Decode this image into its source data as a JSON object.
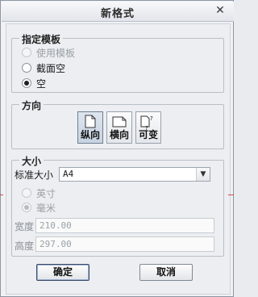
{
  "window": {
    "title": "新格式"
  },
  "template_group": {
    "label": "指定模板",
    "options": [
      {
        "label": "使用模板",
        "checked": false,
        "enabled": false
      },
      {
        "label": "截面空",
        "checked": false,
        "enabled": true
      },
      {
        "label": "空",
        "checked": true,
        "enabled": true
      }
    ]
  },
  "orientation_group": {
    "label": "方向",
    "buttons": [
      {
        "label": "纵向",
        "icon": "portrait-page-icon",
        "active": true
      },
      {
        "label": "横向",
        "icon": "landscape-page-icon",
        "active": false
      },
      {
        "label": "可变",
        "icon": "variable-page-icon",
        "active": false
      }
    ]
  },
  "size_group": {
    "label": "大小",
    "standard_size_label": "标准大小",
    "standard_size_value": "A4",
    "units": [
      {
        "label": "英寸",
        "checked": false,
        "enabled": false
      },
      {
        "label": "毫米",
        "checked": true,
        "enabled": false
      }
    ],
    "width_label": "宽度",
    "width_value": "210.00",
    "height_label": "高度",
    "height_value": "297.00"
  },
  "buttons": {
    "ok": "确定",
    "cancel": "取消"
  },
  "colors": {
    "background": "#eceef1",
    "border": "#b9bfc7",
    "disabled_text": "#9aa0a6",
    "accent_red": "#d24a4a"
  }
}
